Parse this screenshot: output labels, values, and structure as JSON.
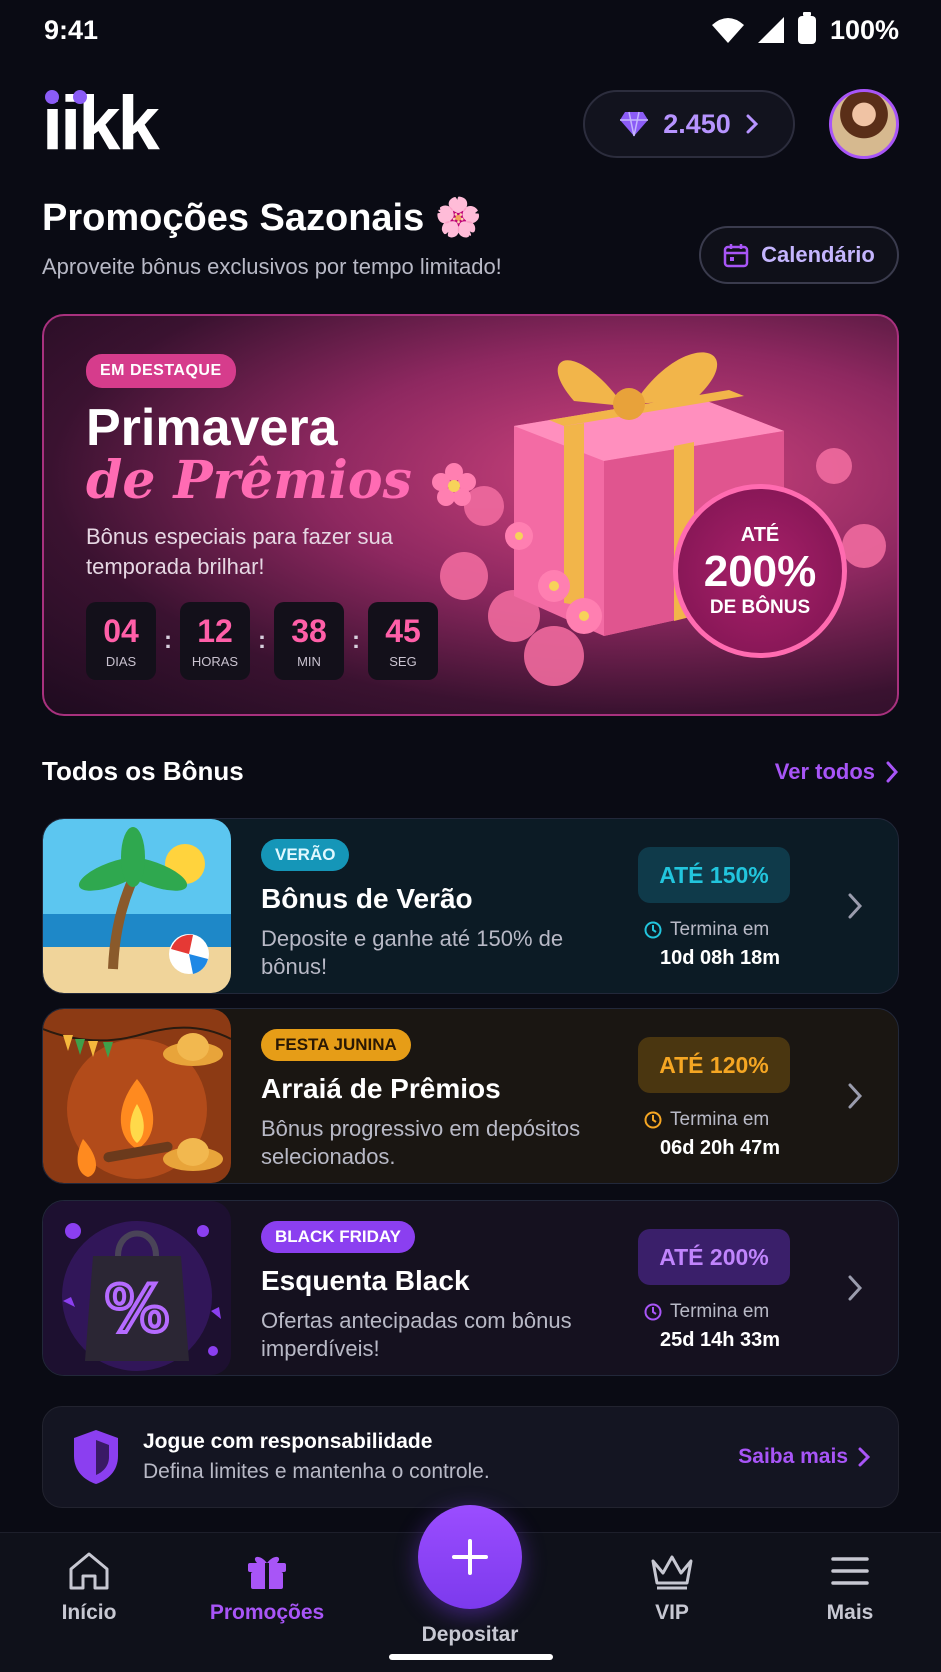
{
  "status_bar": {
    "time": "9:41",
    "battery": "100%"
  },
  "header": {
    "logo": "iikk",
    "gems": "2.450"
  },
  "page": {
    "title": "Promoções Sazonais 🌸",
    "subtitle": "Aproveite bônus exclusivos por tempo limitado!",
    "calendar_label": "Calendário"
  },
  "hero": {
    "badge": "EM DESTAQUE",
    "title_line1": "Primavera",
    "title_line2": "de Prêmios",
    "description": "Bônus especiais para fazer sua temporada brilhar!",
    "countdown": [
      {
        "value": "04",
        "label": "DIAS"
      },
      {
        "value": "12",
        "label": "HORAS"
      },
      {
        "value": "38",
        "label": "MIN"
      },
      {
        "value": "45",
        "label": "SEG"
      }
    ],
    "bonus_top": "ATÉ",
    "bonus_value": "200%",
    "bonus_bottom": "DE BÔNUS"
  },
  "section": {
    "title": "Todos os Bônus",
    "see_all": "Ver todos"
  },
  "bonuses": [
    {
      "tag": "VERÃO",
      "name": "Bônus de Verão",
      "description": "Deposite e ganhe até 150% de bônus!",
      "percent": "ATÉ 150%",
      "ends_label": "Termina em",
      "timer": "10d 08h 18m",
      "accent": "#22c5dd"
    },
    {
      "tag": "FESTA JUNINA",
      "name": "Arraiá de Prêmios",
      "description": "Bônus progressivo em depósitos selecionados.",
      "percent": "ATÉ 120%",
      "ends_label": "Termina em",
      "timer": "06d 20h 47m",
      "accent": "#f5a623"
    },
    {
      "tag": "BLACK FRIDAY",
      "name": "Esquenta Black",
      "description": "Ofertas antecipadas com bônus imperdíveis!",
      "percent": "ATÉ 200%",
      "ends_label": "Termina em",
      "timer": "25d 14h 33m",
      "accent": "#a855f7"
    }
  ],
  "responsible": {
    "title": "Jogue com responsabilidade",
    "subtitle": "Defina limites e mantenha o controle.",
    "link": "Saiba mais"
  },
  "nav": {
    "home": "Início",
    "promos": "Promoções",
    "deposit": "Depositar",
    "vip": "VIP",
    "more": "Mais"
  },
  "colors": {
    "background": "#0a0b14",
    "accent": "#a855f7",
    "pink": "#ff5fa8"
  }
}
